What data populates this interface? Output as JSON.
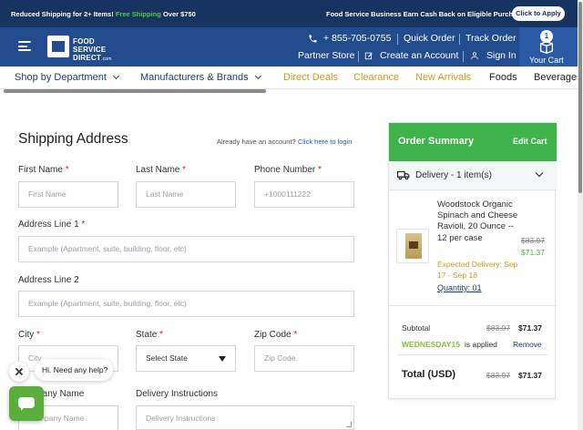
{
  "promo": {
    "left_prefix": "Reduced Shipping for 2+ Items!",
    "left_green": "Free Shipping",
    "left_suffix": "Over $750",
    "right_text": "Food Service Business Earn Cash Back on Eligible Purchases.",
    "apply_button": "Click to Apply"
  },
  "header": {
    "logo_line1": "FOOD SERVICE",
    "logo_line2": "DIRECT",
    "logo_sub": ".com",
    "phone": "+ 855-705-0755",
    "quick_order": "Quick Order",
    "track_order": "Track Order",
    "partner_store": "Partner Store",
    "create_account": "Create an Account",
    "sign_in": "Sign In",
    "cart_count": "1",
    "cart_label": "Your Cart"
  },
  "nav": {
    "items": [
      {
        "label": "Shop by Department"
      },
      {
        "label": "Manufacturers & Brands"
      },
      {
        "label": "Direct Deals"
      },
      {
        "label": "Clearance"
      },
      {
        "label": "New Arrivals"
      },
      {
        "label": "Foods"
      },
      {
        "label": "Beverages"
      }
    ]
  },
  "form": {
    "title": "Shipping Address",
    "login_hint": "Already have an account?",
    "login_link": "Click here to login",
    "first_name_label": "First Name",
    "first_name_placeholder": "First Name",
    "last_name_label": "Last Name",
    "last_name_placeholder": "Last Name",
    "phone_label": "Phone Number",
    "phone_placeholder": "+1000111222",
    "address1_label": "Address Line 1",
    "address1_placeholder": "Example (Apartment, suite, building, floor, etc)",
    "address2_label": "Address Line 2",
    "address2_placeholder": "Example (Apartment, suite, building, floor, etc)",
    "city_label": "City",
    "city_placeholder": "City",
    "state_label": "State",
    "state_value": "Select State",
    "zip_label": "Zip Code",
    "zip_placeholder": "Zip Code",
    "company_label": "Company Name",
    "company_placeholder": "Company Name",
    "instructions_label": "Delivery Instructions",
    "instructions_placeholder": "Delivery Instructions",
    "required_mark": "*"
  },
  "summary": {
    "title": "Order Summary",
    "edit_cart": "Edit Cart",
    "delivery_label": "Delivery - 1 item(s)",
    "product_name": "Woodstock Organic Spinach and Cheese Ravioli, 20 Ounce -- 12 per case",
    "price_old": "$83.97",
    "price_new": "$71.37",
    "expected_delivery": "Expected Delivery: Sep 17 - Sep 18",
    "quantity": "Quantity: 01",
    "subtotal_label": "Subtotal",
    "subtotal_old": "$83.97",
    "subtotal_new": "$71.37",
    "promo_code": "WEDNESDAY15",
    "promo_applied": "is applied",
    "remove": "Remove",
    "total_label": "Total (USD)",
    "total_old": "$83.97",
    "total_new": "$71.37"
  },
  "chat": {
    "greeting": "Hi. Need any help?"
  },
  "icons": {
    "menu": "hamburger-icon",
    "phone": "phone-icon",
    "edit": "edit-icon",
    "user": "user-icon",
    "cart": "cart-icon",
    "truck": "truck-icon"
  },
  "colors": {
    "promo_bg": "#173460",
    "header_bg": "#234c8e",
    "accent_green": "#3db34a",
    "accent_gold": "#d59b1e"
  }
}
